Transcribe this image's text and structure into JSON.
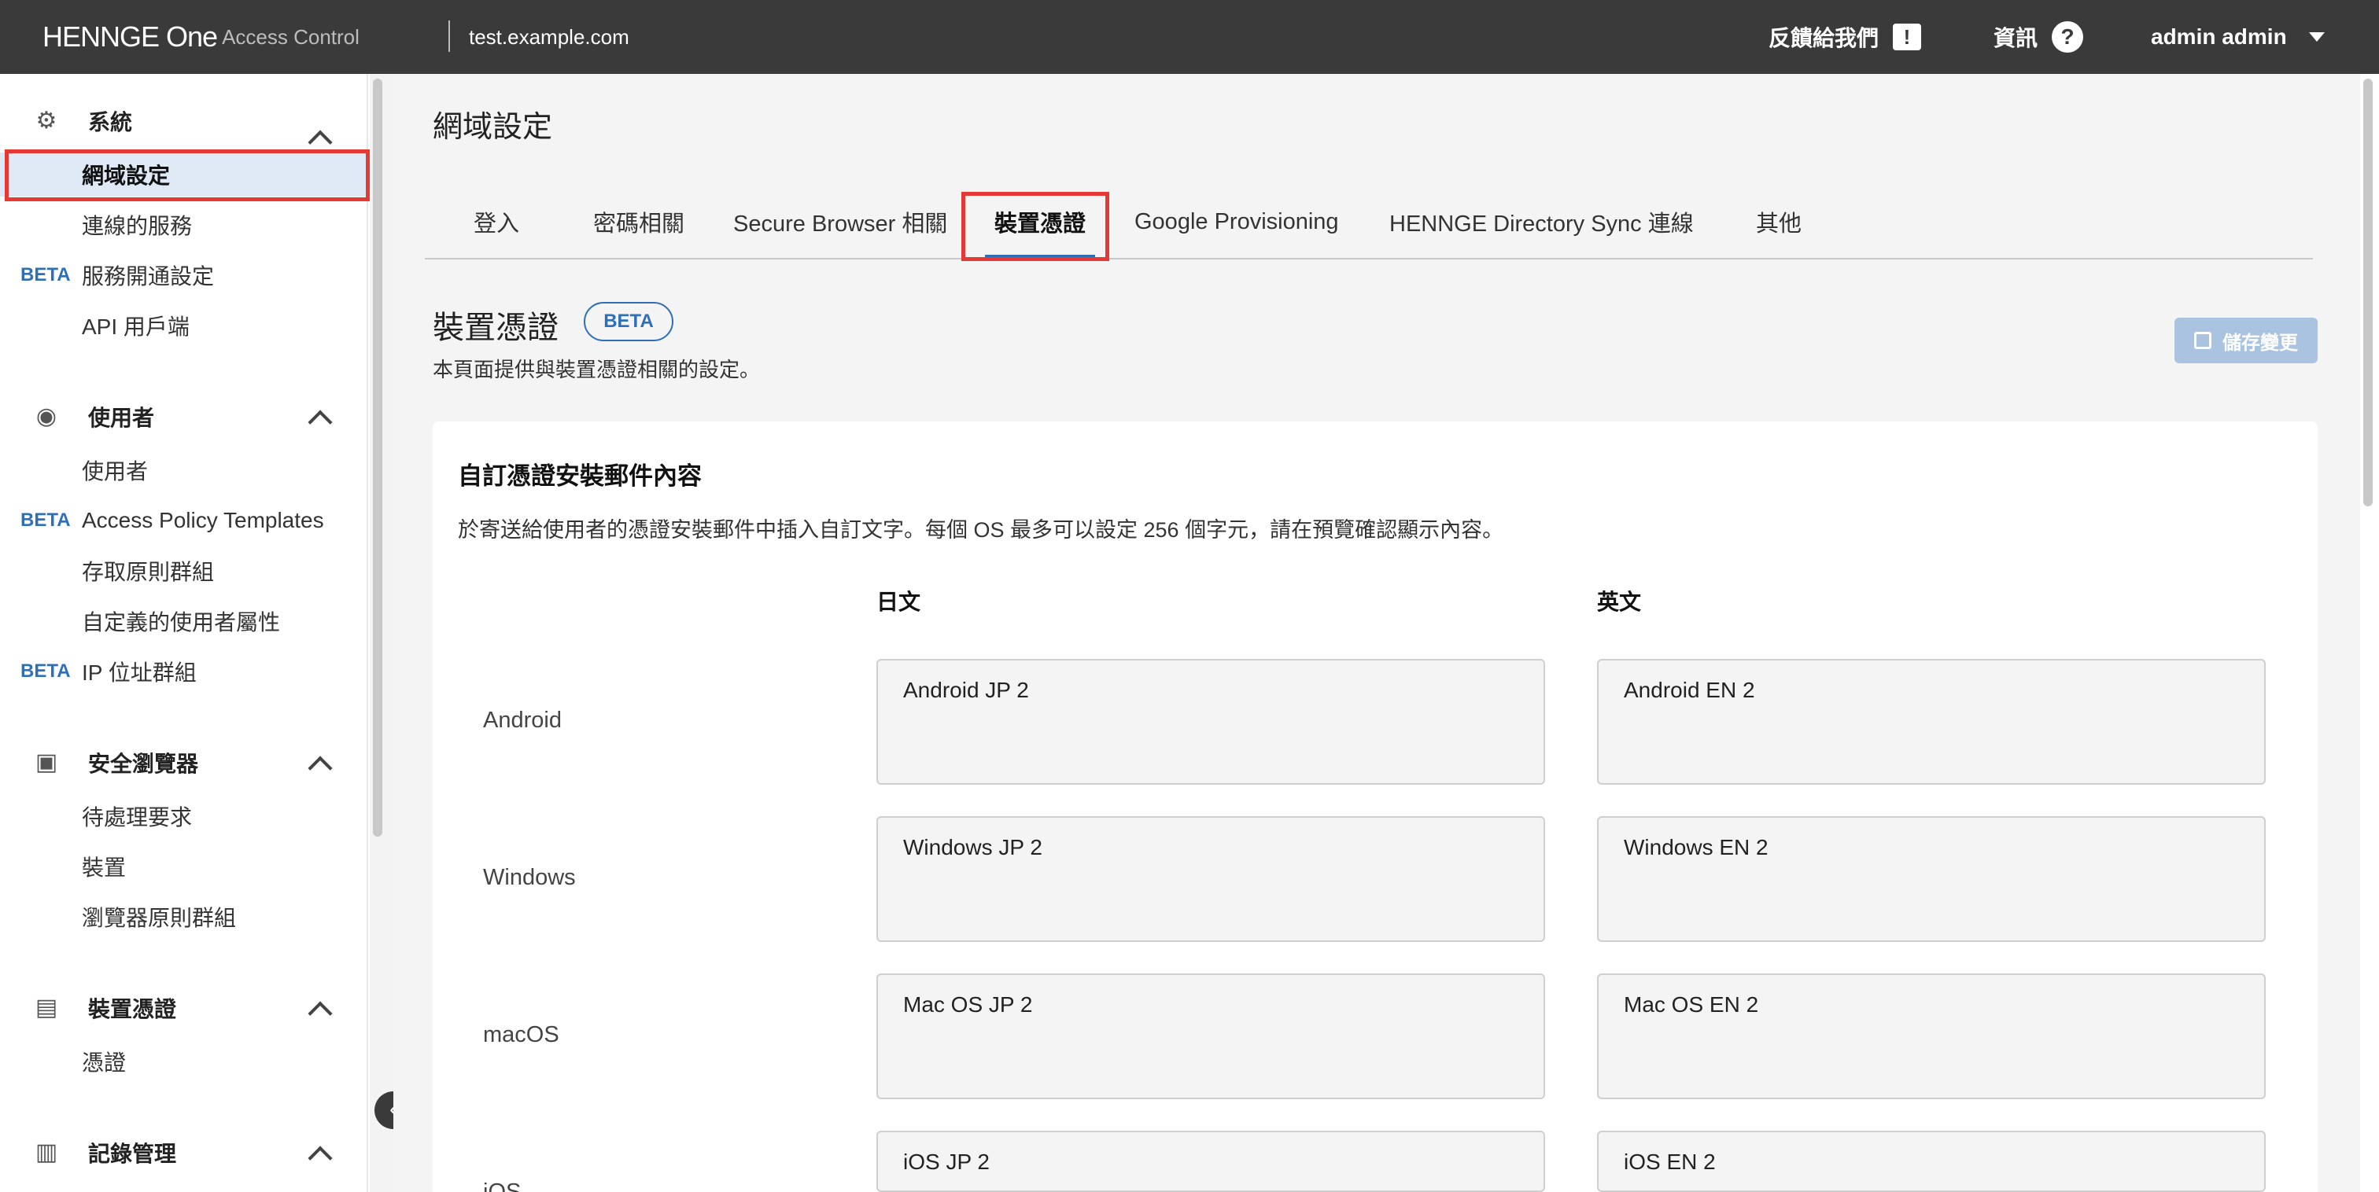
{
  "header": {
    "logo": "HENNGE One",
    "product": "Access Control",
    "tenant": "test.example.com",
    "feedback": "反饋給我們",
    "info": "資訊",
    "user": "admin admin"
  },
  "sidebar": {
    "sections": [
      {
        "title": "系統",
        "items": [
          {
            "label": "網域設定",
            "beta": ""
          },
          {
            "label": "連線的服務",
            "beta": ""
          },
          {
            "label": "服務開通設定",
            "beta": "BETA"
          },
          {
            "label": "API 用戶端",
            "beta": ""
          }
        ]
      },
      {
        "title": "使用者",
        "items": [
          {
            "label": "使用者",
            "beta": ""
          },
          {
            "label": "Access Policy Templates",
            "beta": "BETA"
          },
          {
            "label": "存取原則群組",
            "beta": ""
          },
          {
            "label": "自定義的使用者屬性",
            "beta": ""
          },
          {
            "label": "IP 位址群組",
            "beta": "BETA"
          }
        ]
      },
      {
        "title": "安全瀏覽器",
        "items": [
          {
            "label": "待處理要求",
            "beta": ""
          },
          {
            "label": "裝置",
            "beta": ""
          },
          {
            "label": "瀏覽器原則群組",
            "beta": ""
          }
        ]
      },
      {
        "title": "裝置憑證",
        "items": [
          {
            "label": "憑證",
            "beta": ""
          }
        ]
      },
      {
        "title": "記錄管理",
        "items": []
      }
    ]
  },
  "main": {
    "page_title": "網域設定",
    "tabs": [
      "登入",
      "密碼相關",
      "Secure Browser 相關",
      "裝置憑證",
      "Google Provisioning",
      "HENNGE Directory Sync 連線",
      "其他"
    ],
    "active_tab": "裝置憑證",
    "section_title": "裝置憑證",
    "section_badge": "BETA",
    "section_desc": "本頁面提供與裝置憑證相關的設定。",
    "save_label": "儲存變更",
    "card_title": "自訂憑證安裝郵件內容",
    "card_desc": "於寄送給使用者的憑證安裝郵件中插入自訂文字。每個 OS 最多可以設定 256 個字元，請在預覽確認顯示內容。",
    "col_jp": "日文",
    "col_en": "英文",
    "rows": [
      {
        "os": "Android",
        "jp": "Android JP 2",
        "en": "Android EN 2"
      },
      {
        "os": "Windows",
        "jp": "Windows JP 2",
        "en": "Windows EN 2"
      },
      {
        "os": "macOS",
        "jp": "Mac OS JP 2",
        "en": "Mac OS EN 2"
      },
      {
        "os": "iOS",
        "jp": "iOS JP 2",
        "en": "iOS EN 2"
      }
    ]
  },
  "colors": {
    "topbar": "#3a3a3a",
    "accent": "#2f6fb7",
    "highlight": "#e53935"
  }
}
